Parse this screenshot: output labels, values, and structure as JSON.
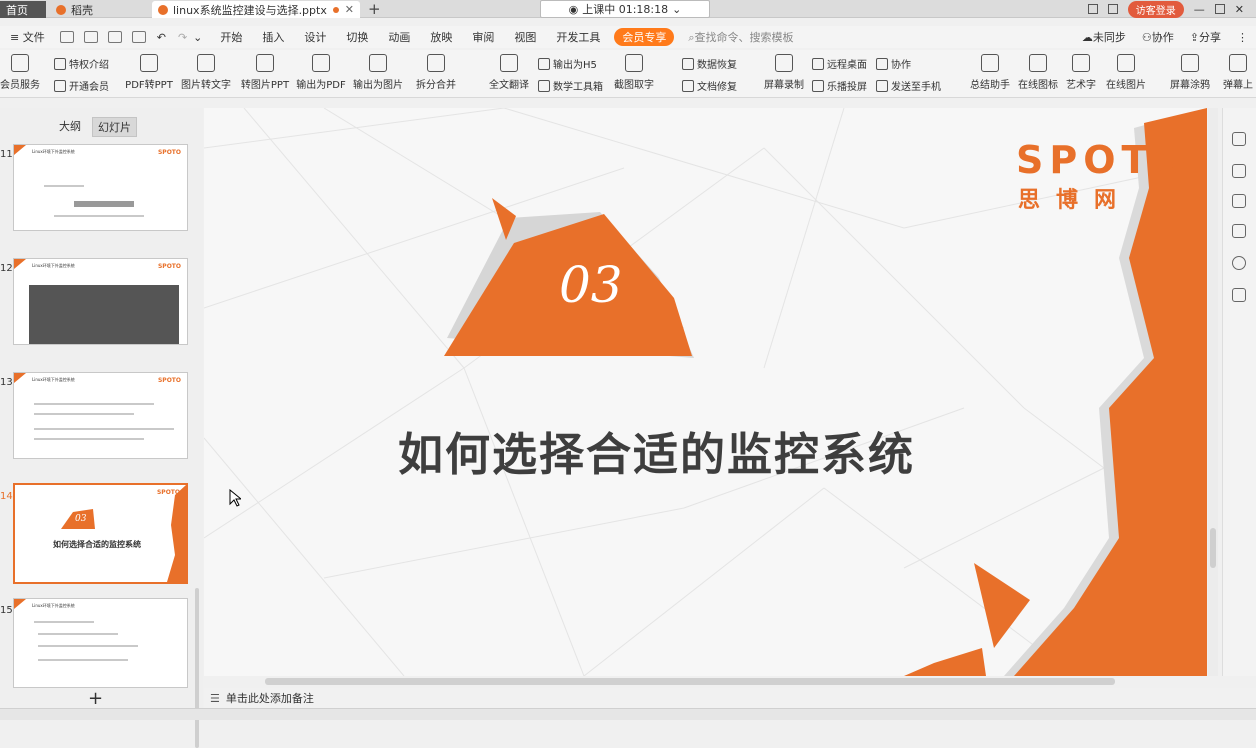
{
  "tabs": {
    "home": "首页",
    "dao": "稻壳",
    "doc": "linux系统监控建设与选择.pptx"
  },
  "lesson_timer": "上课中 01:18:18",
  "login_button": "访客登录",
  "menu": {
    "file": "文件",
    "items": [
      "开始",
      "插入",
      "设计",
      "切换",
      "动画",
      "放映",
      "审阅",
      "视图",
      "开发工具"
    ],
    "vip": "会员专享",
    "search": "查找命令、搜索模板",
    "sync": "未同步",
    "collab": "协作",
    "share": "分享"
  },
  "ribbon": {
    "vip_service": "会员服务",
    "privilege": "特权介绍",
    "open_vip": "开通会员",
    "pdf2ppt": "PDF转PPT",
    "img2text": "图片转文字",
    "img2ppt": "转图片PPT",
    "out_pdf": "输出为PDF",
    "out_img": "输出为图片",
    "split_merge": "拆分合并",
    "translate": "全文翻译",
    "out_h5": "输出为H5",
    "math_tools": "数学工具箱",
    "screenshot_text": "截图取字",
    "data_recover": "数据恢复",
    "doc_repair": "文档修复",
    "screen_record": "屏幕录制",
    "remote_desk": "远程桌面",
    "cast": "乐播投屏",
    "collab2": "协作",
    "send_phone": "发送至手机",
    "summary": "总结助手",
    "online_icon": "在线图标",
    "art_text": "艺术字",
    "online_img": "在线图片",
    "brush": "屏幕涂鸦",
    "danmu": "弹幕上"
  },
  "view_tabs": {
    "outline": "大纲",
    "slides": "幻灯片"
  },
  "thumbnails": [
    {
      "num": "11",
      "title": "Linux环境下外监控系统",
      "logo": "SPOTO"
    },
    {
      "num": "12",
      "title": "Linux环境下外监控系统",
      "logo": "SPOTO"
    },
    {
      "num": "13",
      "title": "Linux环境下外监控系统",
      "logo": "SPOTO"
    },
    {
      "num": "14",
      "title": "如何选择合适的监控系统",
      "logo": "SPOTO",
      "badge": "03"
    },
    {
      "num": "15",
      "title": "Linux环境下外监控系统",
      "logo": ""
    }
  ],
  "slide": {
    "number": "03",
    "title": "如何选择合适的监控系统",
    "logo": "SPOTO",
    "logo_sub": "思博网"
  },
  "notes_placeholder": "单击此处添加备注",
  "colors": {
    "accent": "#E8702A",
    "title": "#3E3E3E"
  }
}
